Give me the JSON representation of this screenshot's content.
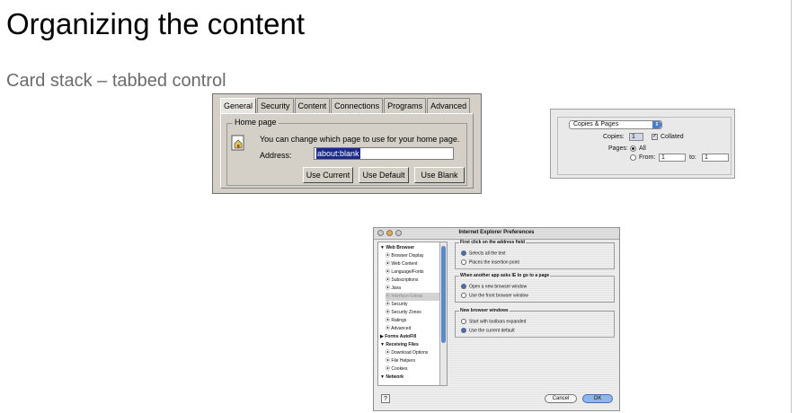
{
  "slide": {
    "title": "Organizing the content",
    "subtitle": "Card stack – tabbed control"
  },
  "win_dialog": {
    "tabs": [
      "General",
      "Security",
      "Content",
      "Connections",
      "Programs",
      "Advanced"
    ],
    "group_label": "Home page",
    "description": "You can change which page to use for your home page.",
    "address_label": "Address:",
    "address_value": "about:blank",
    "buttons": [
      "Use Current",
      "Use Default",
      "Use Blank"
    ]
  },
  "mac_print": {
    "popup_label": "Copies & Pages",
    "copies_label": "Copies:",
    "copies_value": "1",
    "collated_label": "Collated",
    "pages_label": "Pages:",
    "all_label": "All",
    "from_label": "From:",
    "from_value": "1",
    "to_label": "to:",
    "to_value": "1"
  },
  "ie_prefs": {
    "window_title": "Internet Explorer Preferences",
    "sidebar_items": [
      "Web Browser",
      "Browser Display",
      "Web Content",
      "Language/Fonts",
      "Subscriptions",
      "Java",
      "Interface Extras",
      "Security",
      "Security Zones",
      "Ratings",
      "Advanced",
      "Forms AutoFill",
      "Receiving Files",
      "Download Options",
      "File Helpers",
      "Cookies",
      "Network"
    ],
    "groups": [
      {
        "title": "First click on the address field",
        "options": [
          "Selects all the text",
          "Places the insertion point"
        ]
      },
      {
        "title": "When another app asks IE to go to a page",
        "options": [
          "Open a new browser window",
          "Use the front browser window"
        ]
      },
      {
        "title": "New browser windows",
        "options": [
          "Start with toolbars expanded",
          "Use the current default"
        ]
      }
    ],
    "help_label": "?",
    "cancel_label": "Cancel",
    "ok_label": "OK"
  }
}
